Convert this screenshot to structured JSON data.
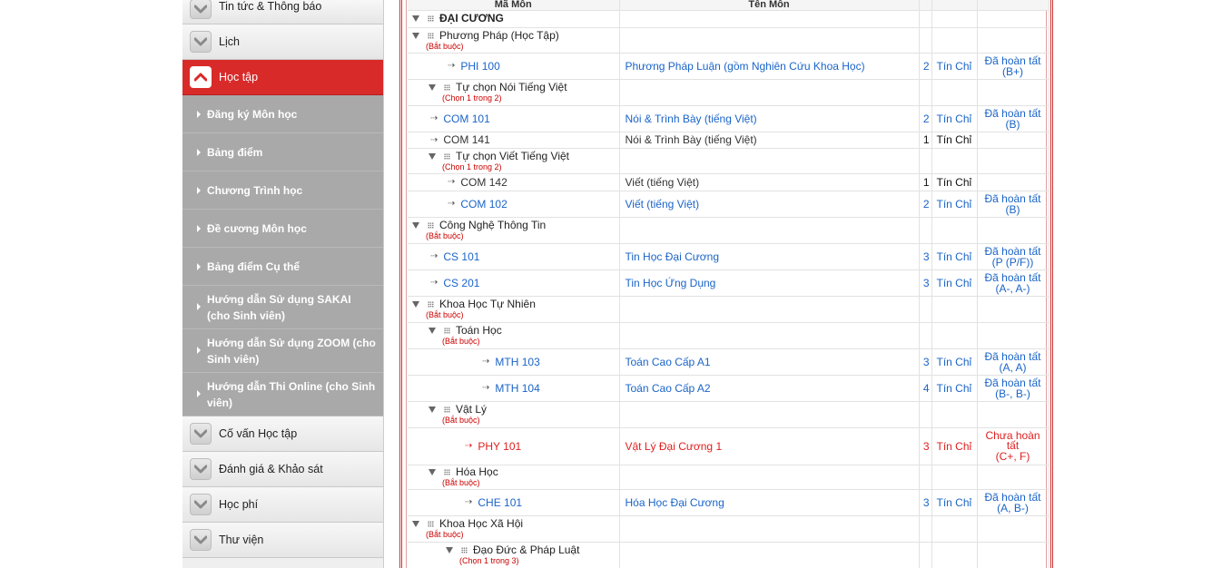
{
  "sidebar": {
    "items": [
      {
        "label": "Tin tức & Thông báo",
        "active": false
      },
      {
        "label": "Lịch",
        "active": false
      },
      {
        "label": "Học tập",
        "active": true
      }
    ],
    "sub_items": [
      {
        "label": "Đăng ký Môn học",
        "lines": 1
      },
      {
        "label": "Bảng điểm",
        "lines": 1
      },
      {
        "label": "Chương Trình học",
        "lines": 1
      },
      {
        "label": "Đề cương Môn học",
        "lines": 1
      },
      {
        "label": "Bảng điểm Cụ thể",
        "lines": 1
      },
      {
        "label": "Hướng dẫn Sử dụng SAKAI (cho Sinh viên)",
        "lines": 2
      },
      {
        "label": "Hướng dẫn Sử dụng ZOOM (cho Sinh viên)",
        "lines": 2
      },
      {
        "label": "Hướng dẫn Thi Online (cho Sinh viên)",
        "lines": 2
      }
    ],
    "bottom_items": [
      {
        "label": "Cố vấn Học tập"
      },
      {
        "label": "Đánh giá & Khảo sát"
      },
      {
        "label": "Học phí"
      },
      {
        "label": "Thư viện"
      }
    ]
  },
  "table": {
    "headers": [
      "Mã Môn",
      "Tên Môn",
      "",
      "",
      ""
    ],
    "rows": [
      {
        "type": "group",
        "level": 0,
        "title": "ĐẠI CƯƠNG",
        "bold": true,
        "note": "",
        "h": 19
      },
      {
        "type": "group",
        "level": 0,
        "title": "Phương Pháp (Học Tập)",
        "note": "(Bắt buộc)",
        "h": 28
      },
      {
        "type": "course",
        "indent": 44,
        "code": "PHI 100",
        "name": "Phương Pháp Luận (gồm Nghiên Cứu Khoa Học)",
        "credits": "2",
        "unit": "Tín Chỉ",
        "status": "Đã hoàn tất",
        "grade": "(B+)",
        "color": "blue",
        "h": 29
      },
      {
        "type": "group",
        "level": 1,
        "title": "Tự chọn Nói Tiếng Việt",
        "note": "(Chọn 1 trong 2)",
        "h": 29
      },
      {
        "type": "course",
        "indent": 25,
        "code": "COM 101",
        "name": "Nói & Trình Bày (tiếng Việt)",
        "credits": "2",
        "unit": "Tín Chỉ",
        "status": "Đã hoàn tất",
        "grade": "(B)",
        "color": "blue",
        "h": 29
      },
      {
        "type": "course",
        "indent": 25,
        "code": "COM 141",
        "name": "Nói & Trình Bày (tiếng Việt)",
        "credits": "1",
        "unit": "Tín Chỉ",
        "status": "",
        "grade": "",
        "color": "dark",
        "h": 18
      },
      {
        "type": "group",
        "level": 1,
        "title": "Tự chọn Viết Tiếng Việt",
        "note": "(Chọn 1 trong 2)",
        "h": 28
      },
      {
        "type": "course",
        "indent": 44,
        "code": "COM 142",
        "name": "Viết (tiếng Việt)",
        "credits": "1",
        "unit": "Tín Chỉ",
        "status": "",
        "grade": "",
        "color": "dark",
        "h": 19
      },
      {
        "type": "course",
        "indent": 44,
        "code": "COM 102",
        "name": "Viết (tiếng Việt)",
        "credits": "2",
        "unit": "Tín Chỉ",
        "status": "Đã hoàn tất",
        "grade": "(B)",
        "color": "blue",
        "h": 29
      },
      {
        "type": "group",
        "level": 0,
        "title": "Công Nghệ Thông Tin",
        "note": "(Bắt buộc)",
        "h": 29
      },
      {
        "type": "course",
        "indent": 25,
        "code": "CS 101",
        "name": "Tin Học Đại Cương",
        "credits": "3",
        "unit": "Tín Chỉ",
        "status": "Đã hoàn tất",
        "grade": "(P (P/F))",
        "color": "blue",
        "h": 29
      },
      {
        "type": "course",
        "indent": 25,
        "code": "CS 201",
        "name": "Tin Học Ứng Dụng",
        "credits": "3",
        "unit": "Tín Chỉ",
        "status": "Đã hoàn tất",
        "grade": "(A-, A-)",
        "color": "blue",
        "h": 29
      },
      {
        "type": "group",
        "level": 0,
        "title": "Khoa Học Tự Nhiên",
        "note": "(Bắt buộc)",
        "h": 29
      },
      {
        "type": "group",
        "level": 1,
        "title": "Toán Học",
        "note": "(Bắt buộc)",
        "h": 29
      },
      {
        "type": "course",
        "indent": 82,
        "code": "MTH 103",
        "name": "Toán Cao Cấp A1",
        "credits": "3",
        "unit": "Tín Chỉ",
        "status": "Đã hoàn tất",
        "grade": "(A, A)",
        "color": "blue",
        "h": 29
      },
      {
        "type": "course",
        "indent": 82,
        "code": "MTH 104",
        "name": "Toán Cao Cấp A2",
        "credits": "4",
        "unit": "Tín Chỉ",
        "status": "Đã hoàn tất",
        "grade": "(B-, B-)",
        "color": "blue",
        "h": 29
      },
      {
        "type": "group",
        "level": 1,
        "title": "Vật Lý",
        "note": "(Bắt buộc)",
        "h": 29
      },
      {
        "type": "course",
        "indent": 63,
        "code": "PHY 101",
        "name": "Vật Lý Đại Cương 1",
        "credits": "3",
        "unit": "Tín Chỉ",
        "status": "Chưa hoàn tất",
        "grade": "(C+, F)",
        "color": "red",
        "h": 41
      },
      {
        "type": "group",
        "level": 1,
        "title": "Hóa Học",
        "note": "(Bắt buộc)",
        "h": 27
      },
      {
        "type": "course",
        "indent": 63,
        "code": "CHE 101",
        "name": "Hóa Học Đại Cương",
        "credits": "3",
        "unit": "Tín Chỉ",
        "status": "Đã hoàn tất",
        "grade": "(A, B-)",
        "color": "blue",
        "h": 29
      },
      {
        "type": "group",
        "level": 0,
        "title": "Khoa Học Xã Hội",
        "note": "(Bắt buộc)",
        "h": 29
      },
      {
        "type": "group",
        "level": 2,
        "title": "Đạo Đức & Pháp Luật",
        "note": "(Chọn 1 trong 3)",
        "h": 29
      }
    ]
  }
}
